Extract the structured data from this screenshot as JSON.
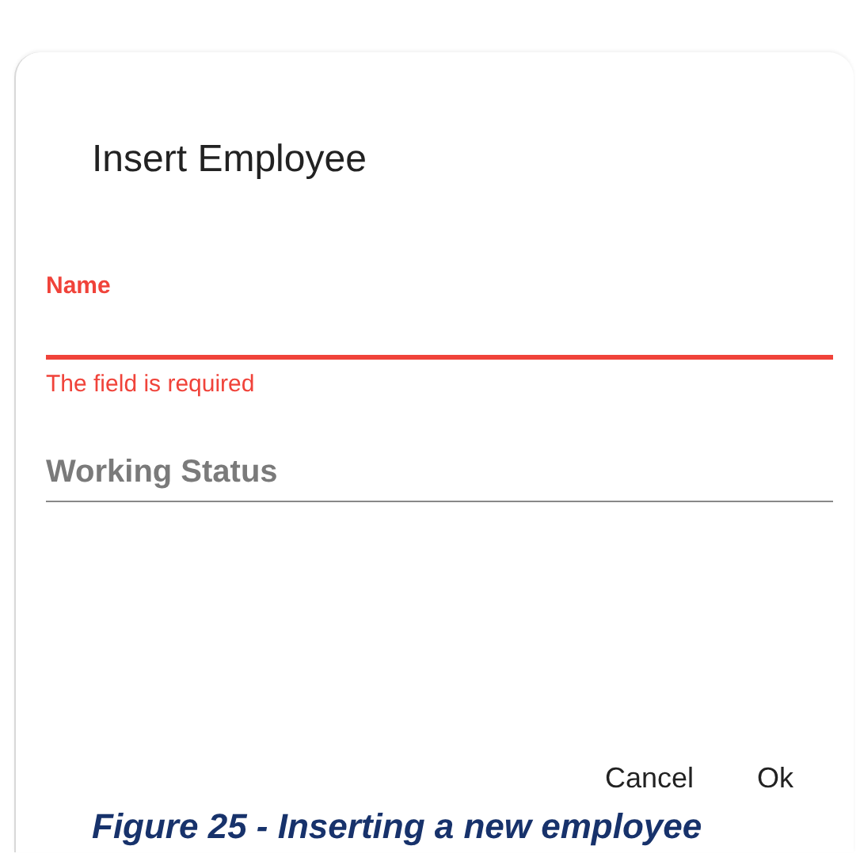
{
  "dialog": {
    "title": "Insert Employee",
    "fields": [
      {
        "label": "Name",
        "invalid": true,
        "error": "The field is required"
      },
      {
        "placeholder": "Working Status",
        "invalid": false
      }
    ],
    "buttons": [
      "Cancel",
      "Ok"
    ]
  },
  "caption": "Figure 25 - Inserting a new employee"
}
